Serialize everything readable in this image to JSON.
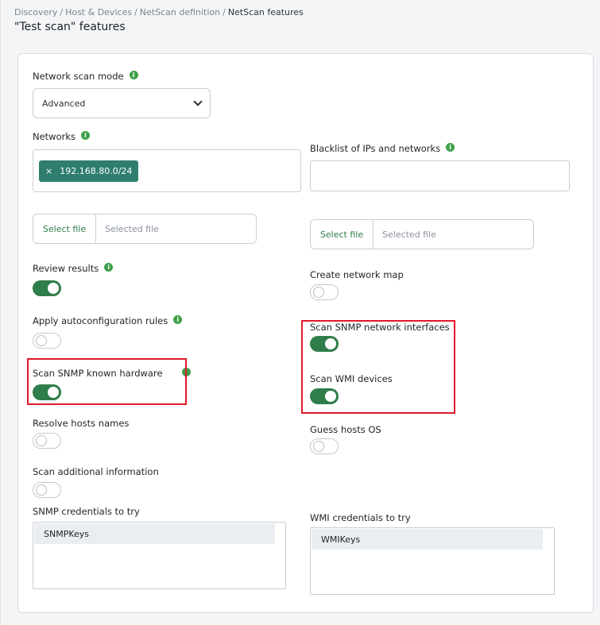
{
  "breadcrumb": {
    "items": [
      "Discovery",
      "Host & Devices",
      "NetScan definition"
    ],
    "current": "NetScan features",
    "separator": "/"
  },
  "page_title": "\"Test scan\" features",
  "info_icon": "i",
  "form": {
    "network_scan_mode": {
      "label": "Network scan mode",
      "value": "Advanced"
    },
    "networks": {
      "label": "Networks",
      "chip_remove": "×",
      "chip": "192.168.80.0/24"
    },
    "blacklist": {
      "label": "Blacklist of IPs and networks",
      "value": ""
    },
    "file_left": {
      "button": "Select file",
      "placeholder": "Selected file"
    },
    "file_right": {
      "button": "Select file",
      "placeholder": "Selected file"
    },
    "review_results": {
      "label": "Review results",
      "checked": true
    },
    "create_network_map": {
      "label": "Create network map",
      "checked": false
    },
    "apply_autoconfig": {
      "label": "Apply autoconfiguration rules",
      "checked": false
    },
    "scan_snmp_interfaces": {
      "label": "Scan SNMP network interfaces",
      "checked": true
    },
    "scan_snmp_hardware": {
      "label": "Scan SNMP known hardware",
      "checked": true
    },
    "scan_wmi_devices": {
      "label": "Scan WMI devices",
      "checked": true
    },
    "resolve_hosts": {
      "label": "Resolve hosts names",
      "checked": false
    },
    "guess_hosts_os": {
      "label": "Guess hosts OS",
      "checked": false
    },
    "scan_additional": {
      "label": "Scan additional information",
      "checked": false
    },
    "snmp_credentials": {
      "label": "SNMP credentials to try",
      "items": [
        "SNMPKeys"
      ]
    },
    "wmi_credentials": {
      "label": "WMI credentials to try",
      "items": [
        "WMIKeys"
      ]
    }
  },
  "colors": {
    "accent": "#2f7d4a",
    "chip": "#2f7d6d",
    "info": "#3fa14a",
    "highlight": "#e0192b"
  },
  "icons": {
    "dropdown": "chevron-down-icon",
    "info": "info-icon",
    "chip_remove": "close-icon"
  }
}
